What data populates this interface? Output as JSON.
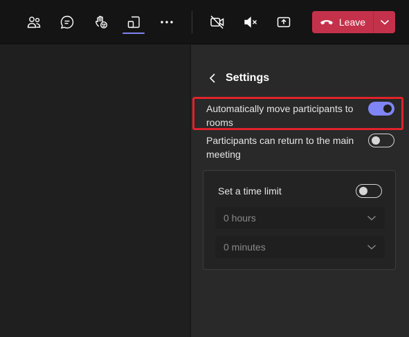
{
  "toolbar": {
    "leave_label": "Leave"
  },
  "panel": {
    "title": "Settings",
    "auto_move": {
      "label": "Automatically move participants to rooms",
      "enabled": true
    },
    "return_main": {
      "label": "Participants can return to the main meeting",
      "enabled": false
    },
    "time_limit": {
      "label": "Set a time limit",
      "enabled": false,
      "hours_value": "0 hours",
      "minutes_value": "0 minutes"
    }
  },
  "colors": {
    "accent": "#7f85f5",
    "leave": "#c4314b",
    "highlight": "#e0232b"
  }
}
